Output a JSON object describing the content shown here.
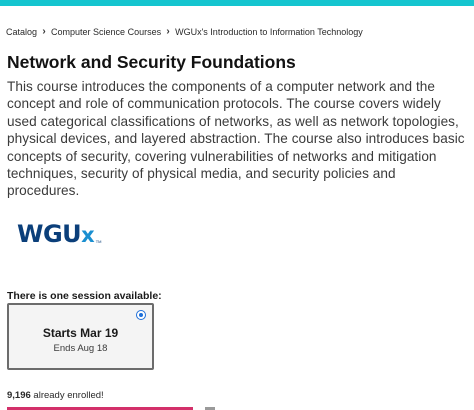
{
  "colors": {
    "topbar": "#15c5cf",
    "logo_primary": "#0b3f7a",
    "logo_accent": "#1a8fd0",
    "radio_selected": "#1e6fd9",
    "enroll_button": "#d3306a"
  },
  "breadcrumb": {
    "items": [
      "Catalog",
      "Computer Science Courses",
      "WGUx's Introduction to Information Technology"
    ],
    "separator_icon": "chevron-right-icon"
  },
  "course": {
    "title": "Network and Security Foundations",
    "description": "This course introduces the components of a computer network and the concept and role of communication protocols. The course covers widely used categorical classifications of networks, as well as network topologies, physical devices, and layered abstraction. The course also introduces basic concepts of security, covering vulnerabilities of networks and mitigation techniques, security of physical media, and security policies and procedures."
  },
  "logo": {
    "text": "WGU",
    "suffix": "x",
    "trademark": "TM"
  },
  "sessions": {
    "label": "There is one session available:",
    "items": [
      {
        "starts": "Starts Mar 19",
        "ends": "Ends Aug 18",
        "selected": true
      }
    ]
  },
  "enrollment": {
    "count": "9,196",
    "suffix": " already enrolled!"
  }
}
